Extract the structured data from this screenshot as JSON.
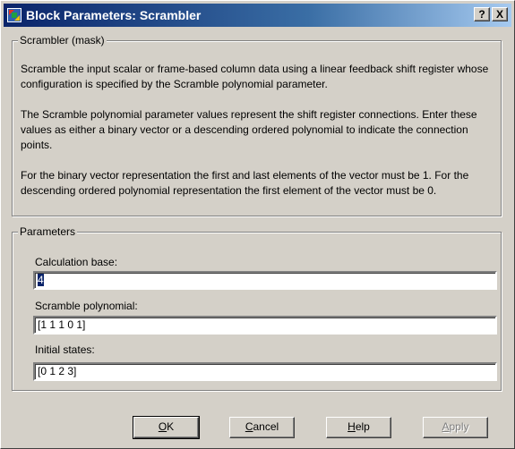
{
  "window": {
    "title": "Block Parameters: Scrambler",
    "help_caption": "?",
    "close_caption": "X"
  },
  "description": {
    "legend": "Scrambler (mask)",
    "paragraph1": "Scramble the input scalar or frame-based column data using a linear feedback shift register whose configuration is specified by the Scramble polynomial parameter.",
    "paragraph2": "The Scramble polynomial parameter values represent the shift register connections. Enter these values as either a binary vector or a descending ordered polynomial to indicate the connection points.",
    "paragraph3": "For the binary vector representation the first and last elements of the vector must be 1. For the descending ordered polynomial representation the first element of the vector must be 0."
  },
  "parameters": {
    "legend": "Parameters",
    "calculation_base": {
      "label": "Calculation base:",
      "value": "4"
    },
    "scramble_polynomial": {
      "label": "Scramble polynomial:",
      "value": "[1 1 1 0 1]"
    },
    "initial_states": {
      "label": "Initial states:",
      "value": "[0 1 2 3]"
    }
  },
  "buttons": {
    "ok": {
      "mnemonic": "O",
      "rest": "K"
    },
    "cancel": {
      "mnemonic": "C",
      "rest": "ancel"
    },
    "help": {
      "mnemonic": "H",
      "rest": "elp"
    },
    "apply": {
      "mnemonic": "A",
      "rest": "pply"
    }
  },
  "colors": {
    "titlebar_start": "#0a246a",
    "titlebar_end": "#a6caf0",
    "dialog_face": "#d4d0c8"
  }
}
